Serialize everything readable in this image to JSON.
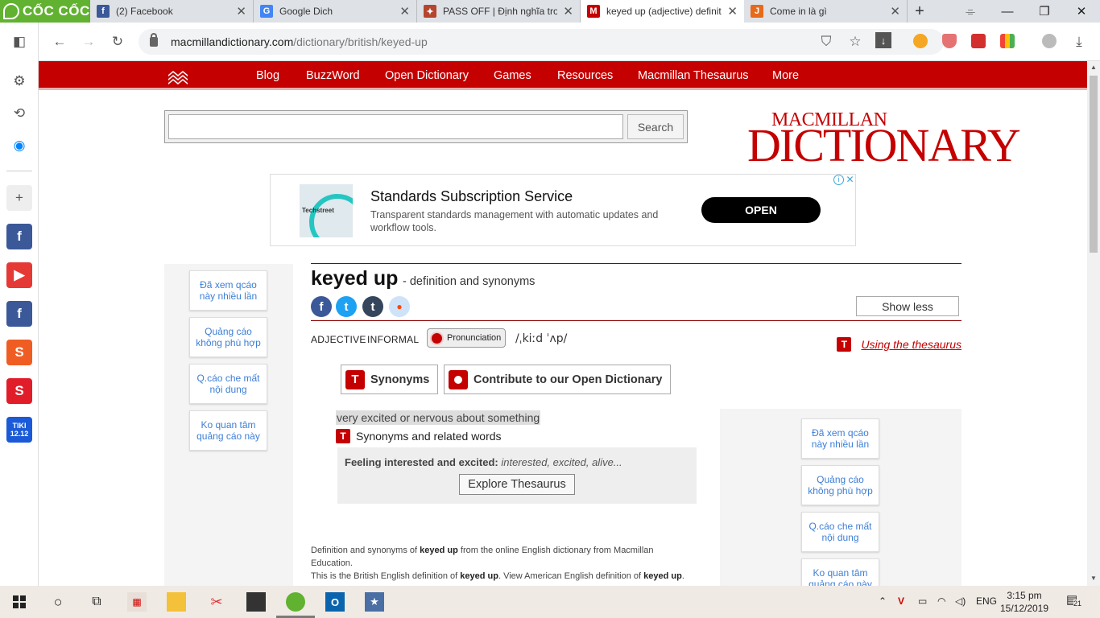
{
  "browser": {
    "logo_text": "CỐC CỐC",
    "tabs": [
      {
        "title": "(2) Facebook",
        "favicon": "f",
        "color": "#3b5998"
      },
      {
        "title": "Google Dich",
        "favicon": "G",
        "color": "#4285f4"
      },
      {
        "title": "PASS OFF | Định nghĩa trong",
        "favicon": "✦",
        "color": "#b5452f"
      },
      {
        "title": "keyed up (adjective) definiti",
        "favicon": "M",
        "color": "#c40000"
      },
      {
        "title": "Come in là gì",
        "favicon": "J",
        "color": "#e66a19"
      }
    ],
    "url_host": "macmillandictionary.com",
    "url_path": "/dictionary/british/keyed-up"
  },
  "site": {
    "nav": [
      "Blog",
      "BuzzWord",
      "Open Dictionary",
      "Games",
      "Resources",
      "Macmillan Thesaurus",
      "More"
    ],
    "search_button": "Search",
    "brand_top": "MACMILLAN",
    "brand_bottom": "DICTIONARY"
  },
  "ad": {
    "brand": "Techstreet",
    "title": "Standards Subscription Service",
    "description": "Transparent standards management with automatic updates and workflow tools.",
    "cta": "OPEN"
  },
  "ad_options": [
    "Đã xem qcáo này nhiều lần",
    "Quảng cáo không phù hợp",
    "Q.cáo che mất nội dung",
    "Ko quan tâm quảng cáo này"
  ],
  "entry": {
    "headword": "keyed up",
    "subtitle": "- definition and synonyms",
    "show_less": "Show less",
    "pos": "ADJECTIVE",
    "register": "INFORMAL",
    "pronunciation_label": "Pronunciation",
    "ipa": "/ˌkiːd ˈʌp/",
    "thesaurus_link": "Using the thesaurus",
    "tab_synonyms": "Synonyms",
    "tab_contribute": "Contribute to our Open Dictionary",
    "definition": "very excited or nervous about something",
    "synonyms_heading": "Synonyms and related words",
    "thes_category": "Feeling interested and excited:",
    "thes_words": "interested, excited, alive...",
    "explore_button": "Explore Thesaurus",
    "footer_1a": "Definition and synonyms of ",
    "footer_1b": "keyed up",
    "footer_1c": " from the online English dictionary from Macmillan Education.",
    "footer_2a": "This is the British English definition of ",
    "footer_2b": "keyed up",
    "footer_2c": ". View American English definition of ",
    "footer_2d": "keyed up",
    "footer_2e": "."
  },
  "taskbar": {
    "lang": "ENG",
    "time": "3:15 pm",
    "date": "15/12/2019",
    "notifications": "21"
  }
}
